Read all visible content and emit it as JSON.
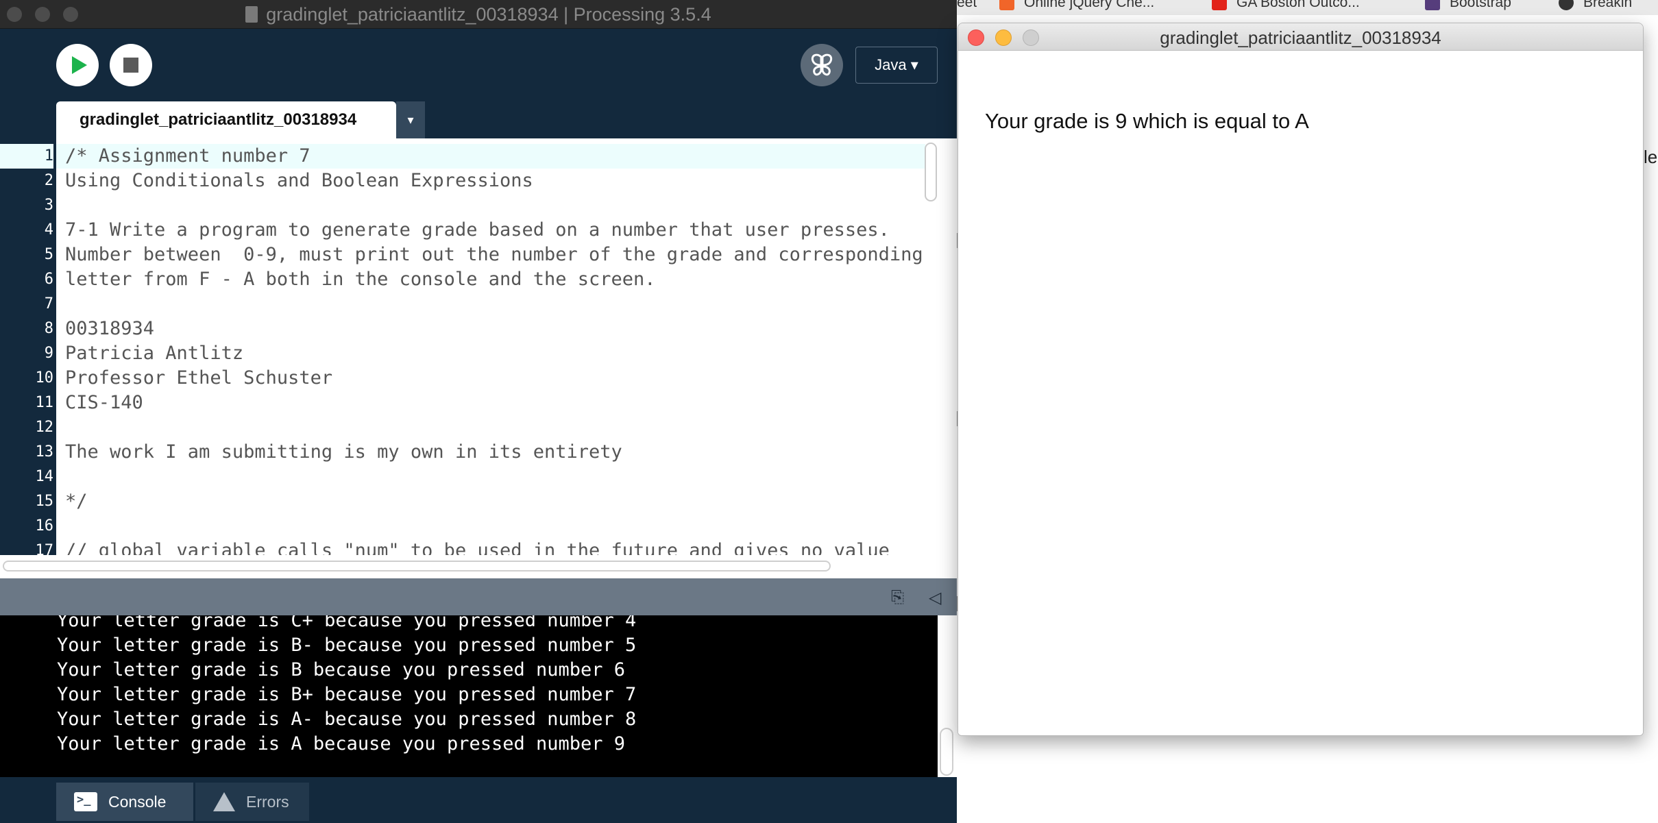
{
  "browser_bookmarks": [
    {
      "label": "eet",
      "color": ""
    },
    {
      "label": "Online jQuery Che...",
      "color": "#f16529"
    },
    {
      "label": "GA Boston Outco...",
      "color": "#e2231a"
    },
    {
      "label": "Bootstrap",
      "color": "#563d7c"
    },
    {
      "label": "Breakin",
      "color": "#333333"
    }
  ],
  "background_edge_text": "le",
  "ide": {
    "window_title": "gradinglet_patriciaantlitz_00318934 | Processing 3.5.4",
    "run_label": "Run",
    "stop_label": "Stop",
    "mode": "Java ▾",
    "tab_name": "gradinglet_patriciaantlitz_00318934",
    "tab_menu": "▾",
    "current_line": 1,
    "editor_lines": [
      {
        "num": "1",
        "text": "/* Assignment number 7"
      },
      {
        "num": "2",
        "text": "Using Conditionals and Boolean Expressions"
      },
      {
        "num": "3",
        "text": ""
      },
      {
        "num": "4",
        "text": "7-1 Write a program to generate grade based on a number that user presses."
      },
      {
        "num": "5",
        "text": "Number between  0-9, must print out the number of the grade and corresponding"
      },
      {
        "num": "6",
        "text": "letter from F - A both in the console and the screen."
      },
      {
        "num": "7",
        "text": ""
      },
      {
        "num": "8",
        "text": "00318934"
      },
      {
        "num": "9",
        "text": "Patricia Antlitz"
      },
      {
        "num": "10",
        "text": "Professor Ethel Schuster"
      },
      {
        "num": "11",
        "text": "CIS-140"
      },
      {
        "num": "12",
        "text": ""
      },
      {
        "num": "13",
        "text": "The work I am submitting is my own in its entirety"
      },
      {
        "num": "14",
        "text": ""
      },
      {
        "num": "15",
        "text": "*/"
      },
      {
        "num": "16",
        "text": ""
      },
      {
        "num": "17",
        "text": "// global variable calls \"num\" to be used in the future and gives no value"
      }
    ],
    "console_lines": [
      "Your letter grade is C+ because you pressed number 4",
      "Your letter grade is B- because you pressed number 5",
      "Your letter grade is B because you pressed number 6",
      "Your letter grade is B+ because you pressed number 7",
      "Your letter grade is A- because you pressed number 8",
      "Your letter grade is A because you pressed number 9"
    ],
    "footer_tabs": {
      "console": "Console",
      "errors": "Errors"
    }
  },
  "sketch_window": {
    "title": "gradinglet_patriciaantlitz_00318934",
    "output_text": "Your grade is 9 which is equal to A"
  },
  "colors": {
    "ide_background": "#13293d",
    "run_green": "#1cb34c",
    "close_red": "#fc605c",
    "minimize_yellow": "#fdbc40"
  }
}
